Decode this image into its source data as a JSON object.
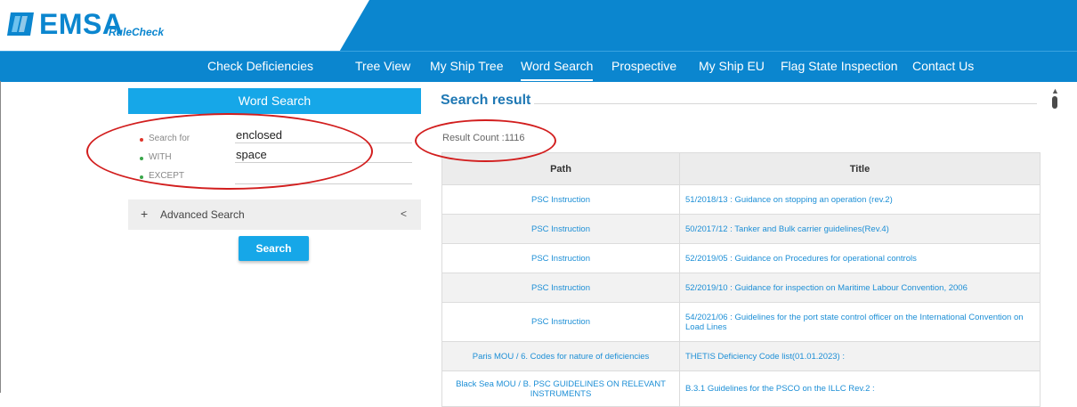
{
  "brand": {
    "name": "EMSA",
    "sub": "RuleCheck",
    "color": "#0b86cf"
  },
  "nav": {
    "items": [
      {
        "label": "Check Deficiencies"
      },
      {
        "label": "Tree View"
      },
      {
        "label": "My Ship Tree"
      },
      {
        "label": "Word Search",
        "active": true
      },
      {
        "label": "Prospective"
      },
      {
        "label": "My Ship EU"
      },
      {
        "label": "Flag State Inspection"
      },
      {
        "label": "Contact Us"
      }
    ]
  },
  "word_search": {
    "title": "Word Search",
    "fields": [
      {
        "label": "Search for",
        "value": "enclosed",
        "dot_color": "#e0352b"
      },
      {
        "label": "WITH",
        "value": "space",
        "dot_color": "#3aa64b"
      },
      {
        "label": "EXCEPT",
        "value": "",
        "dot_color": "#3aa64b"
      }
    ],
    "advanced_label": "Advanced Search",
    "advanced_plus": "+",
    "advanced_chevron": "<",
    "search_button": "Search"
  },
  "results": {
    "title": "Search result",
    "count_text": "Result Count :1116",
    "columns": [
      "Path",
      "Title"
    ],
    "rows": [
      {
        "path": "PSC Instruction",
        "title": "51/2018/13 : Guidance on stopping an operation (rev.2)"
      },
      {
        "path": "PSC Instruction",
        "title": "50/2017/12 : Tanker and Bulk carrier guidelines(Rev.4)"
      },
      {
        "path": "PSC Instruction",
        "title": "52/2019/05 : Guidance on Procedures for operational controls"
      },
      {
        "path": "PSC Instruction",
        "title": "52/2019/10 : Guidance for inspection on Maritime Labour Convention, 2006"
      },
      {
        "path": "PSC Instruction",
        "title": "54/2021/06 : Guidelines for the port state control officer on the International Convention on Load Lines"
      },
      {
        "path": "Paris MOU / 6. Codes for nature of deficiencies",
        "title": "THETIS Deficiency Code list(01.01.2023) :"
      },
      {
        "path": "Black Sea MOU / B. PSC GUIDELINES ON RELEVANT INSTRUMENTS",
        "title": "B.3.1 Guidelines for the PSCO on the ILLC Rev.2 :"
      }
    ]
  },
  "colors": {
    "accent": "#16a7e8",
    "link": "#1d8fd6",
    "annotation": "#d21e1e"
  }
}
